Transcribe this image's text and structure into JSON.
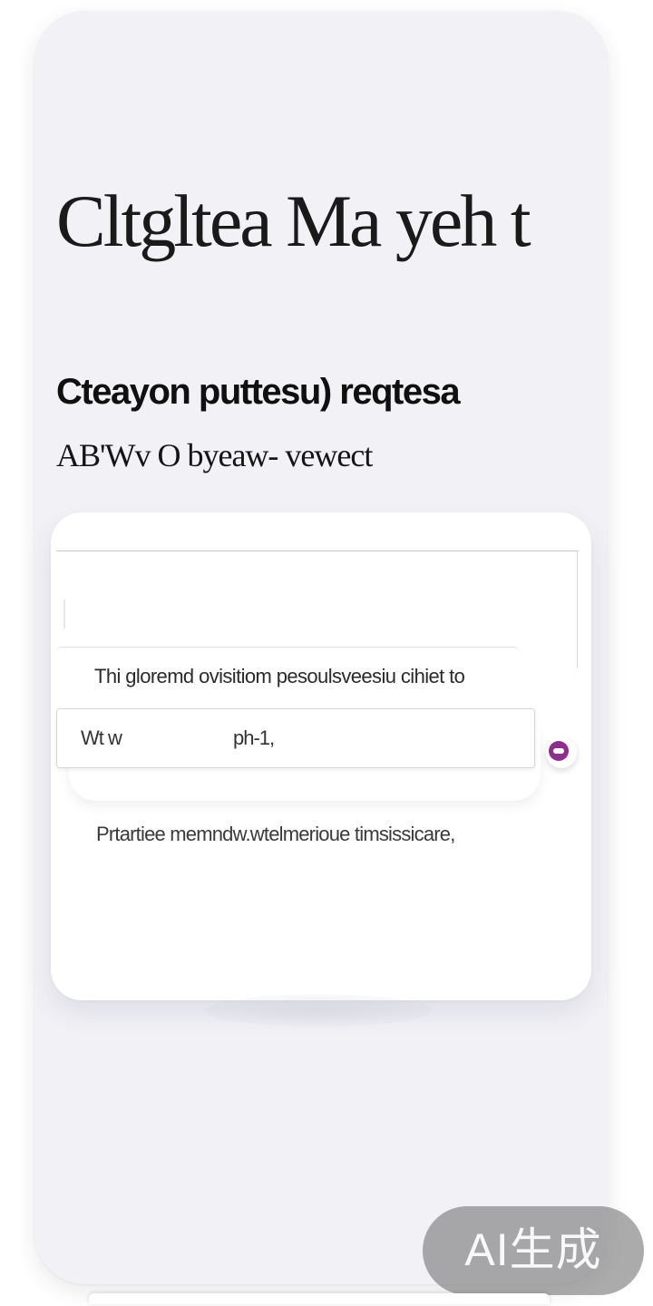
{
  "screen": {
    "title": "Cltgltea Ma yeh t",
    "section_heading": "Cteayon puttesu) reqtesa",
    "section_subheading": "AB'Wv O byeaw- vewect"
  },
  "form": {
    "description": "Thi gloremd ovisitiom pesoulsveesiu cihiet to",
    "input_label": "Wt w",
    "input_value": "ph-1,",
    "toggle_state": "on",
    "footnote": "Prtartiee memndw.wtelmerioue timsissicare,"
  },
  "watermark": {
    "text": "AI生成"
  },
  "colors": {
    "background": "#ffffff",
    "phone_card": "#f1f1f6",
    "content_card": "#ffffff",
    "accent_dot": "#8e2f8d",
    "text_primary": "#1a1a1a",
    "watermark_bg": "#787878"
  }
}
